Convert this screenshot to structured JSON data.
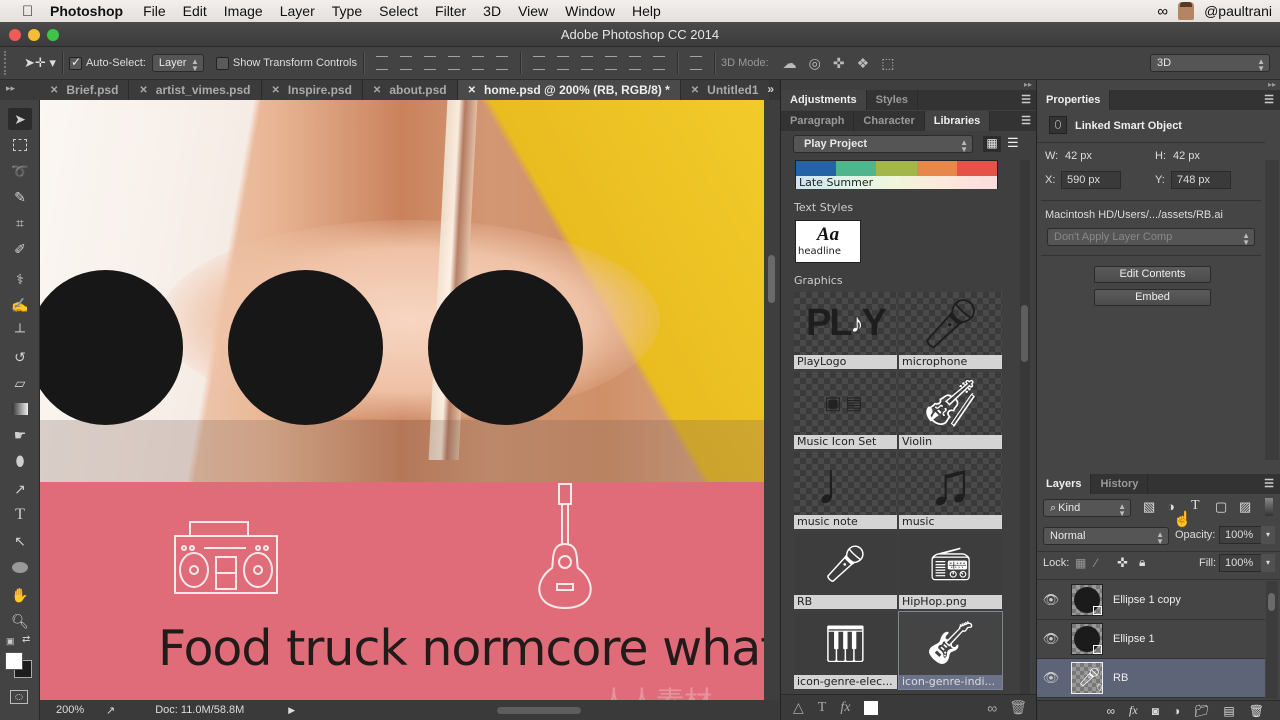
{
  "menubar": {
    "app_name": "Photoshop",
    "items": [
      "File",
      "Edit",
      "Image",
      "Layer",
      "Type",
      "Select",
      "Filter",
      "3D",
      "View",
      "Window",
      "Help"
    ],
    "user": "@paultrani"
  },
  "window": {
    "title": "Adobe Photoshop CC 2014"
  },
  "options_bar": {
    "auto_select_label": "Auto-Select:",
    "auto_select_checked": true,
    "auto_select_value": "Layer",
    "transform_label": "Show Transform Controls",
    "transform_checked": false,
    "mode_3d_label": "3D Mode:",
    "workspace_value": "3D"
  },
  "doc_tabs": [
    {
      "label": "Brief.psd",
      "active": false
    },
    {
      "label": "artist_vimes.psd",
      "active": false
    },
    {
      "label": "Inspire.psd",
      "active": false
    },
    {
      "label": "about.psd",
      "active": false
    },
    {
      "label": "home.psd @ 200% (RB, RGB/8) *",
      "active": true
    },
    {
      "label": "Untitled1",
      "active": false
    }
  ],
  "canvas": {
    "headline": "Food truck normcore what",
    "pink_color": "#e06c79"
  },
  "status_bar": {
    "zoom": "200%",
    "doc_size": "Doc: 11.0M/58.8M"
  },
  "middle_panel": {
    "tabs_top": [
      {
        "label": "Adjustments",
        "active": true
      },
      {
        "label": "Styles",
        "active": false
      }
    ],
    "tabs_lib": [
      {
        "label": "Paragraph",
        "active": false
      },
      {
        "label": "Character",
        "active": false
      },
      {
        "label": "Libraries",
        "active": true
      }
    ],
    "library_select": "Play Project",
    "color_theme": {
      "name": "Late Summer",
      "colors": [
        "#2563a8",
        "#4fb58c",
        "#a3b64a",
        "#e8874a",
        "#e55248"
      ]
    },
    "text_styles_heading": "Text Styles",
    "text_style_sample": "Aa",
    "text_style_name": "headline",
    "graphics_heading": "Graphics",
    "graphics": [
      {
        "label": "PlayLogo",
        "selected": false
      },
      {
        "label": "microphone",
        "selected": false
      },
      {
        "label": "Music Icon Set",
        "selected": false
      },
      {
        "label": "Violin",
        "selected": false
      },
      {
        "label": "music note",
        "selected": false
      },
      {
        "label": "music",
        "selected": false
      },
      {
        "label": "RB",
        "selected": false
      },
      {
        "label": "HipHop.png",
        "selected": false
      },
      {
        "label": "icon-genre-elec...",
        "selected": false
      },
      {
        "label": "icon-genre-indi...",
        "selected": true
      }
    ]
  },
  "properties": {
    "tab": "Properties",
    "type": "Linked Smart Object",
    "w_label": "W:",
    "w": "42 px",
    "h_label": "H:",
    "h": "42 px",
    "x_label": "X:",
    "x": "590 px",
    "y_label": "Y:",
    "y": "748 px",
    "path": "Macintosh HD/Users/.../assets/RB.ai",
    "layer_comp": "Don't Apply Layer Comp",
    "edit_contents": "Edit Contents",
    "embed": "Embed"
  },
  "layers_panel": {
    "tabs": [
      {
        "label": "Layers",
        "active": true
      },
      {
        "label": "History",
        "active": false
      }
    ],
    "filter": "Kind",
    "blend_mode": "Normal",
    "opacity_label": "Opacity:",
    "opacity": "100%",
    "lock_label": "Lock:",
    "fill_label": "Fill:",
    "fill": "100%",
    "layers": [
      {
        "name": "Ellipse 1 copy",
        "visible": true,
        "selected": false
      },
      {
        "name": "Ellipse 1",
        "visible": true,
        "selected": false
      },
      {
        "name": "RB",
        "visible": true,
        "selected": true
      }
    ]
  }
}
